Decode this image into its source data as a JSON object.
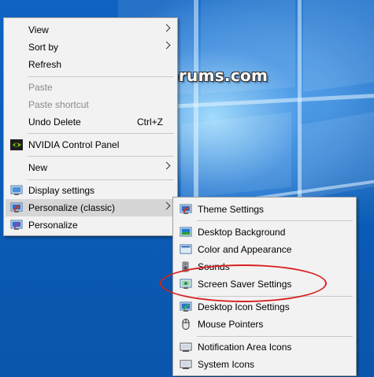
{
  "watermark": "TenForums.com",
  "main_menu": {
    "items": [
      {
        "label": "View",
        "submenu": true
      },
      {
        "label": "Sort by",
        "submenu": true
      },
      {
        "label": "Refresh"
      },
      {
        "label": "Paste",
        "disabled": true
      },
      {
        "label": "Paste shortcut",
        "disabled": true
      },
      {
        "label": "Undo Delete",
        "shortcut": "Ctrl+Z"
      },
      {
        "label": "NVIDIA Control Panel",
        "icon": "nvidia-icon"
      },
      {
        "label": "New",
        "submenu": true
      },
      {
        "label": "Display settings",
        "icon": "display-settings-icon"
      },
      {
        "label": "Personalize (classic)",
        "icon": "personalize-classic-icon",
        "submenu": true,
        "highlighted": true
      },
      {
        "label": "Personalize",
        "icon": "personalize-icon"
      }
    ]
  },
  "sub_menu": {
    "items": [
      {
        "label": "Theme Settings",
        "icon": "theme-settings-icon"
      },
      {
        "label": "Desktop Background",
        "icon": "desktop-background-icon"
      },
      {
        "label": "Color and Appearance",
        "icon": "color-appearance-icon"
      },
      {
        "label": "Sounds",
        "icon": "speaker-icon"
      },
      {
        "label": "Screen Saver Settings",
        "icon": "screen-saver-icon",
        "annotated": true
      },
      {
        "label": "Desktop Icon Settings",
        "icon": "desktop-icon-settings-icon"
      },
      {
        "label": "Mouse Pointers",
        "icon": "mouse-icon"
      },
      {
        "label": "Notification Area Icons",
        "icon": "notification-area-icon"
      },
      {
        "label": "System Icons",
        "icon": "system-icons-icon"
      }
    ]
  },
  "colors": {
    "annotation": "#d8201f",
    "menu_background": "#f2f2f2",
    "highlight": "#d6d6d6",
    "desktop": "#0b5bb6"
  }
}
